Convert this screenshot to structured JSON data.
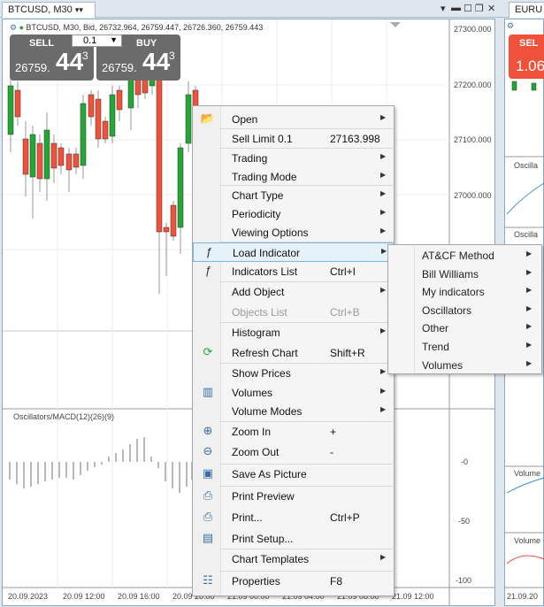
{
  "tabs": {
    "active": "BTCUSD, M30",
    "second": "EURU"
  },
  "chart": {
    "info": "BTCUSD, M30, Bid, 26732.964, 26759.447, 26726.360, 26759.443",
    "sell_label": "SELL",
    "buy_label": "BUY",
    "lot": "0.1",
    "sell_small": "26759.",
    "sell_big": "44",
    "sell_sup": "3",
    "buy_small": "26759.",
    "buy_big": "44",
    "buy_sup": "3",
    "price_axis": [
      "27300.000",
      "27200.000",
      "27100.000",
      "27000.000"
    ],
    "osc_label": "Oscillators/MACD(12)(26)(9)",
    "osc_axis": [
      "-0",
      "-50",
      "-100"
    ],
    "time_axis": [
      "20.09.2023",
      "20.09 12:00",
      "20.09 16:00",
      "20.09 20:00",
      "21.09 00:00",
      "21.09 04:00",
      "21.09 08:00",
      "21.09 12:00"
    ],
    "colors": {
      "bull": "#22a833",
      "bear": "#f0513a",
      "osc": "#b8b8b8"
    }
  },
  "chart2": {
    "sell_label": "SEL",
    "big": "1.06",
    "osc_label": "Oscilla",
    "osc_label2": "Oscilla",
    "volume_label": "Volume",
    "volume_label2": "Volume",
    "time_label": "21.09.20"
  },
  "context_menu": {
    "items": [
      {
        "label": "Open",
        "shortcut": "",
        "arrow": "▶",
        "icon": "folder-icon"
      },
      {
        "label": "Sell Limit 0.1",
        "shortcut": "27163.998",
        "arrow": "",
        "icon": ""
      },
      {
        "label": "Trading",
        "shortcut": "",
        "arrow": "▶",
        "icon": ""
      },
      {
        "label": "Trading Mode",
        "shortcut": "",
        "arrow": "▶",
        "icon": ""
      },
      {
        "label": "Chart Type",
        "shortcut": "",
        "arrow": "▶",
        "icon": ""
      },
      {
        "label": "Periodicity",
        "shortcut": "",
        "arrow": "▶",
        "icon": ""
      },
      {
        "label": "Viewing Options",
        "shortcut": "",
        "arrow": "▶",
        "icon": ""
      },
      {
        "label": "Load Indicator",
        "shortcut": "",
        "arrow": "▶",
        "icon": "function-icon"
      },
      {
        "label": "Indicators List",
        "shortcut": "Ctrl+I",
        "arrow": "",
        "icon": "function-list-icon"
      },
      {
        "label": "Add Object",
        "shortcut": "",
        "arrow": "▶",
        "icon": ""
      },
      {
        "label": "Objects List",
        "shortcut": "Ctrl+B",
        "arrow": "",
        "icon": ""
      },
      {
        "label": "Histogram",
        "shortcut": "",
        "arrow": "▶",
        "icon": ""
      },
      {
        "label": "Refresh Chart",
        "shortcut": "Shift+R",
        "arrow": "",
        "icon": "refresh-icon"
      },
      {
        "label": "Show Prices",
        "shortcut": "",
        "arrow": "▶",
        "icon": ""
      },
      {
        "label": "Volumes",
        "shortcut": "",
        "arrow": "▶",
        "icon": "volume-bars-icon"
      },
      {
        "label": "Volume Modes",
        "shortcut": "",
        "arrow": "▶",
        "icon": ""
      },
      {
        "label": "Zoom In",
        "shortcut": "+",
        "arrow": "",
        "icon": "zoom-in-icon"
      },
      {
        "label": "Zoom Out",
        "shortcut": "-",
        "arrow": "",
        "icon": "zoom-out-icon"
      },
      {
        "label": "Save As Picture",
        "shortcut": "",
        "arrow": "",
        "icon": "save-picture-icon"
      },
      {
        "label": "Print Preview",
        "shortcut": "",
        "arrow": "",
        "icon": "print-preview-icon"
      },
      {
        "label": "Print...",
        "shortcut": "Ctrl+P",
        "arrow": "",
        "icon": "printer-icon"
      },
      {
        "label": "Print Setup...",
        "shortcut": "",
        "arrow": "",
        "icon": "print-setup-icon"
      },
      {
        "label": "Chart Templates",
        "shortcut": "",
        "arrow": "▶",
        "icon": ""
      },
      {
        "label": "Properties",
        "shortcut": "F8",
        "arrow": "",
        "icon": "properties-icon"
      }
    ]
  },
  "submenu": {
    "items": [
      {
        "label": "AT&CF Method",
        "arrow": "▶"
      },
      {
        "label": "Bill Williams",
        "arrow": "▶"
      },
      {
        "label": "My indicators",
        "arrow": "▶"
      },
      {
        "label": "Oscillators",
        "arrow": "▶"
      },
      {
        "label": "Other",
        "arrow": "▶"
      },
      {
        "label": "Trend",
        "arrow": "▶"
      },
      {
        "label": "Volumes",
        "arrow": "▶"
      }
    ]
  }
}
